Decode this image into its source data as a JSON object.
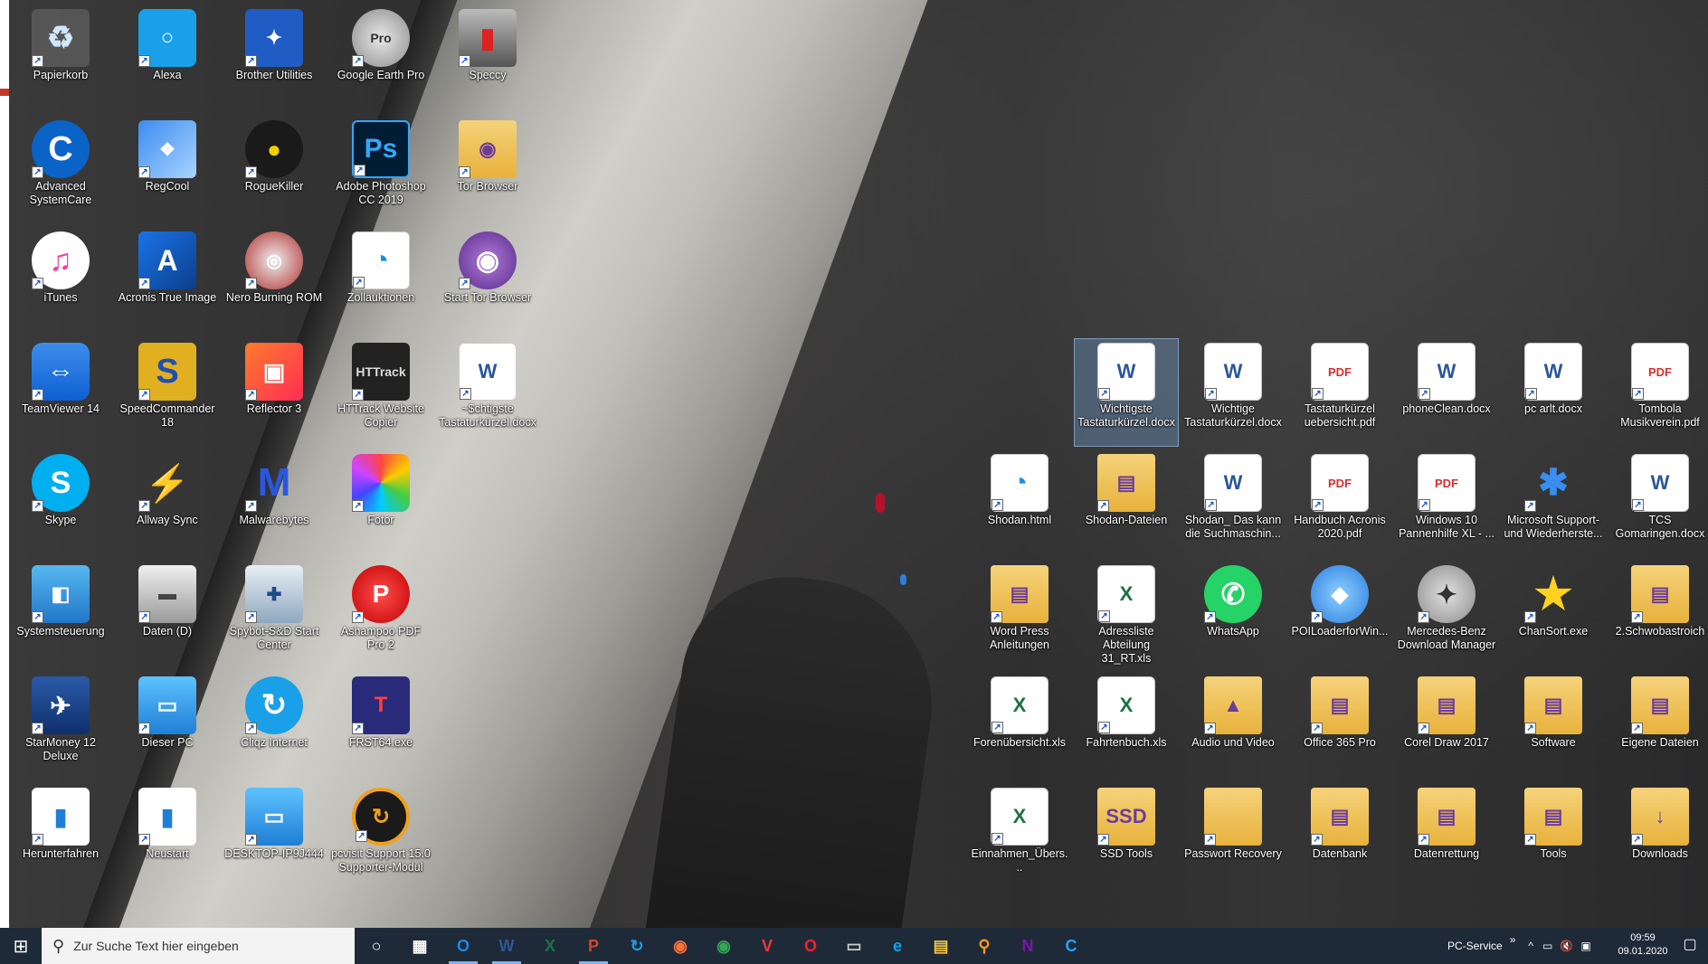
{
  "desktop": {
    "icons_left": [
      {
        "label": "Papierkorb",
        "icon": "recycle-bin",
        "style": "recycle",
        "glyph": "♻"
      },
      {
        "label": "Alexa",
        "icon": "alexa-app",
        "style": "alexa",
        "glyph": "○"
      },
      {
        "label": "Brother Utilities",
        "icon": "brother-utilities",
        "style": "brother",
        "glyph": "✦"
      },
      {
        "label": "Google Earth Pro",
        "icon": "google-earth-pro",
        "style": "earth",
        "glyph": "Pro"
      },
      {
        "label": "Speccy",
        "icon": "speccy",
        "style": "speccy",
        "glyph": "▮"
      },
      {
        "label": "Advanced SystemCare",
        "icon": "advanced-systemcare",
        "style": "asc",
        "glyph": "C"
      },
      {
        "label": "RegCool",
        "icon": "regcool",
        "style": "regcool",
        "glyph": "❖"
      },
      {
        "label": "RogueKiller",
        "icon": "roguekiller",
        "style": "rogue",
        "glyph": "●"
      },
      {
        "label": "Adobe Photoshop CC 2019",
        "icon": "photoshop",
        "style": "ps",
        "glyph": "Ps"
      },
      {
        "label": "Tor Browser",
        "icon": "tor-browser-folder",
        "style": "folder",
        "glyph": "◉"
      },
      {
        "label": "iTunes",
        "icon": "itunes",
        "style": "itunes",
        "glyph": "♫"
      },
      {
        "label": "Acronis True Image",
        "icon": "acronis",
        "style": "acronis",
        "glyph": "A"
      },
      {
        "label": "Nero Burning ROM",
        "icon": "nero",
        "style": "nero",
        "glyph": "◎"
      },
      {
        "label": "Zollauktionen",
        "icon": "zollauktionen",
        "style": "zoll",
        "glyph": "◔"
      },
      {
        "label": "Start Tor Browser",
        "icon": "tor-browser",
        "style": "tor",
        "glyph": "◉"
      },
      {
        "label": "TeamViewer 14",
        "icon": "teamviewer",
        "style": "tv",
        "glyph": "⇔"
      },
      {
        "label": "SpeedCommander 18",
        "icon": "speedcommander",
        "style": "speedc",
        "glyph": "S"
      },
      {
        "label": "Reflector 3",
        "icon": "reflector",
        "style": "reflector",
        "glyph": "▣"
      },
      {
        "label": "HTTrack Website Copier",
        "icon": "httrack",
        "style": "httrack",
        "glyph": "HTTrack"
      },
      {
        "label": "~$chtigste Tastaturkürzel.docx",
        "icon": "word-document",
        "style": "word",
        "glyph": "W"
      },
      {
        "label": "Skype",
        "icon": "skype",
        "style": "skype",
        "glyph": "S"
      },
      {
        "label": "Allway Sync",
        "icon": "allway-sync",
        "style": "allway",
        "glyph": "⚡"
      },
      {
        "label": "Malwarebytes",
        "icon": "malwarebytes",
        "style": "malware",
        "glyph": "M"
      },
      {
        "label": "Fotor",
        "icon": "fotor",
        "style": "fotor",
        "glyph": ""
      },
      {
        "label": "",
        "icon": "empty",
        "style": "",
        "glyph": ""
      },
      {
        "label": "Systemsteuerung",
        "icon": "control-panel",
        "style": "syssteu",
        "glyph": "◧"
      },
      {
        "label": "Daten (D)",
        "icon": "drive",
        "style": "drive",
        "glyph": "▬"
      },
      {
        "label": "Spybot-S&D Start Center",
        "icon": "spybot",
        "style": "spybot",
        "glyph": "✚"
      },
      {
        "label": "Ashampoo PDF Pro 2",
        "icon": "ashampoo-pdf",
        "style": "ashampoo",
        "glyph": "P"
      },
      {
        "label": "",
        "icon": "empty",
        "style": "",
        "glyph": ""
      },
      {
        "label": "StarMoney 12 Deluxe",
        "icon": "starmoney",
        "style": "starmoney",
        "glyph": "✈"
      },
      {
        "label": "Dieser PC",
        "icon": "this-pc",
        "style": "monitor",
        "glyph": "▭"
      },
      {
        "label": "Cliqz Internet",
        "icon": "cliqz",
        "style": "cliqz",
        "glyph": "↻"
      },
      {
        "label": "FRST64.exe",
        "icon": "frst",
        "style": "frst",
        "glyph": "T"
      },
      {
        "label": "",
        "icon": "empty",
        "style": "",
        "glyph": ""
      },
      {
        "label": "Herunterfahren",
        "icon": "shutdown",
        "style": "winwhite",
        "glyph": "▮"
      },
      {
        "label": "Neustart",
        "icon": "restart",
        "style": "winwhite",
        "glyph": "▮"
      },
      {
        "label": "DESKTOP-IP9J444",
        "icon": "remote-desktop",
        "style": "monitor",
        "glyph": "▭"
      },
      {
        "label": "pcvisit Support 15.0 Supporter-Modul",
        "icon": "pcvisit",
        "style": "pcvisit",
        "glyph": "↻"
      },
      {
        "label": "",
        "icon": "empty",
        "style": "",
        "glyph": ""
      }
    ],
    "icons_right": [
      {
        "label": "Wichtigste Tastaturkürzel.docx",
        "icon": "word-document",
        "style": "word",
        "glyph": "W",
        "selected": true
      },
      {
        "label": "Wichtige Tastaturkürzel.docx",
        "icon": "word-document",
        "style": "word",
        "glyph": "W"
      },
      {
        "label": "Tastaturkürzel uebersicht.pdf",
        "icon": "pdf-document",
        "style": "pdf",
        "glyph": "PDF"
      },
      {
        "label": "phoneClean.docx",
        "icon": "word-document",
        "style": "word",
        "glyph": "W"
      },
      {
        "label": "pc arlt.docx",
        "icon": "word-document",
        "style": "word",
        "glyph": "W"
      },
      {
        "label": "Tombola Musikverein.pdf",
        "icon": "pdf-document",
        "style": "pdf",
        "glyph": "PDF"
      },
      {
        "label": "Shodan.html",
        "icon": "shodan-html",
        "style": "shodan",
        "glyph": "◔"
      },
      {
        "label": "Shodan-Dateien",
        "icon": "folder",
        "style": "folder",
        "glyph": "▤"
      },
      {
        "label": "Shodan_ Das kann die Suchmaschin...",
        "icon": "word-document",
        "style": "word",
        "glyph": "W"
      },
      {
        "label": "Handbuch Acronis 2020.pdf",
        "icon": "pdf-document",
        "style": "pdf",
        "glyph": "PDF"
      },
      {
        "label": "Windows 10 Pannenhilfe XL - ...",
        "icon": "pdf-document",
        "style": "pdf",
        "glyph": "PDF"
      },
      {
        "label": "Microsoft Support- und Wiederherste...",
        "icon": "microsoft-support",
        "style": "msfix",
        "glyph": "✱"
      },
      {
        "label": "TCS Gomaringen.docx",
        "icon": "word-document",
        "style": "word",
        "glyph": "W"
      },
      {
        "label": "Word Press Anleitungen",
        "icon": "folder",
        "style": "folder",
        "glyph": "▤"
      },
      {
        "label": "Adressliste Abteilung 31_RT.xls",
        "icon": "excel-document",
        "style": "excel",
        "glyph": "X"
      },
      {
        "label": "WhatsApp",
        "icon": "whatsapp",
        "style": "whatsapp",
        "glyph": "✆"
      },
      {
        "label": "POILoaderforWin...",
        "icon": "poiloader",
        "style": "poi",
        "glyph": "◆"
      },
      {
        "label": "Mercedes-Benz Download Manager",
        "icon": "mercedes",
        "style": "merc",
        "glyph": "✦"
      },
      {
        "label": "ChanSort.exe",
        "icon": "chansort",
        "style": "star",
        "glyph": "★"
      },
      {
        "label": "2.Schwobastroich",
        "icon": "folder",
        "style": "folder",
        "glyph": "▤"
      },
      {
        "label": "Forenübersicht.xls",
        "icon": "excel-document",
        "style": "excel",
        "glyph": "X"
      },
      {
        "label": "Fahrtenbuch.xls",
        "icon": "excel-document",
        "style": "excel",
        "glyph": "X"
      },
      {
        "label": "Audio und Video",
        "icon": "folder",
        "style": "folder",
        "glyph": "▲"
      },
      {
        "label": "Office 365 Pro",
        "icon": "folder",
        "style": "folder",
        "glyph": "▤"
      },
      {
        "label": "Corel Draw 2017",
        "icon": "folder",
        "style": "folder",
        "glyph": "▤"
      },
      {
        "label": "Software",
        "icon": "folder",
        "style": "folder",
        "glyph": "▤"
      },
      {
        "label": "Eigene Dateien",
        "icon": "folder",
        "style": "folder",
        "glyph": "▤"
      },
      {
        "label": "Einnahmen_Übers...",
        "icon": "excel-document",
        "style": "excel",
        "glyph": "X"
      },
      {
        "label": "SSD Tools",
        "icon": "folder",
        "style": "folder",
        "glyph": "SSD"
      },
      {
        "label": "Passwort Recovery",
        "icon": "folder",
        "style": "folder",
        "glyph": ""
      },
      {
        "label": "Datenbank",
        "icon": "folder",
        "style": "folder",
        "glyph": "▤"
      },
      {
        "label": "Datenrettung",
        "icon": "folder",
        "style": "folder",
        "glyph": "▤"
      },
      {
        "label": "Tools",
        "icon": "folder",
        "style": "folder",
        "glyph": "▤"
      },
      {
        "label": "Downloads",
        "icon": "downloads-folder",
        "style": "folder",
        "glyph": "↓"
      }
    ]
  },
  "taskbar": {
    "search_placeholder": "Zur Suche Text hier eingeben",
    "apps": [
      {
        "name": "cortana-icon",
        "glyph": "○",
        "color": "#ffffff"
      },
      {
        "name": "task-view-icon",
        "glyph": "▦",
        "color": "#ffffff"
      },
      {
        "name": "outlook-icon",
        "glyph": "O",
        "color": "#1e88e5",
        "active": true
      },
      {
        "name": "word-icon",
        "glyph": "W",
        "color": "#2b579a",
        "active": true
      },
      {
        "name": "excel-icon",
        "glyph": "X",
        "color": "#1e7145"
      },
      {
        "name": "powerpoint-icon",
        "glyph": "P",
        "color": "#d24726",
        "active": true
      },
      {
        "name": "cliqz-icon",
        "glyph": "↻",
        "color": "#1aa0e8"
      },
      {
        "name": "firefox-icon",
        "glyph": "◉",
        "color": "#ff7139"
      },
      {
        "name": "chrome-icon",
        "glyph": "◉",
        "color": "#34a853"
      },
      {
        "name": "vivaldi-icon",
        "glyph": "V",
        "color": "#ef3939"
      },
      {
        "name": "opera-icon",
        "glyph": "O",
        "color": "#ff1b2d"
      },
      {
        "name": "terminal-icon",
        "glyph": "▭",
        "color": "#cccccc"
      },
      {
        "name": "edge-icon",
        "glyph": "e",
        "color": "#0ea5e9"
      },
      {
        "name": "file-explorer-icon",
        "glyph": "▤",
        "color": "#f5c542"
      },
      {
        "name": "search-app-icon",
        "glyph": "⚲",
        "color": "#ff9a1a"
      },
      {
        "name": "onenote-icon",
        "glyph": "N",
        "color": "#7719aa"
      },
      {
        "name": "ccleaner-icon",
        "glyph": "C",
        "color": "#2aa0ff"
      }
    ],
    "tray_label": "PC-Service",
    "time": "09:59",
    "date": "09.01.2020"
  }
}
